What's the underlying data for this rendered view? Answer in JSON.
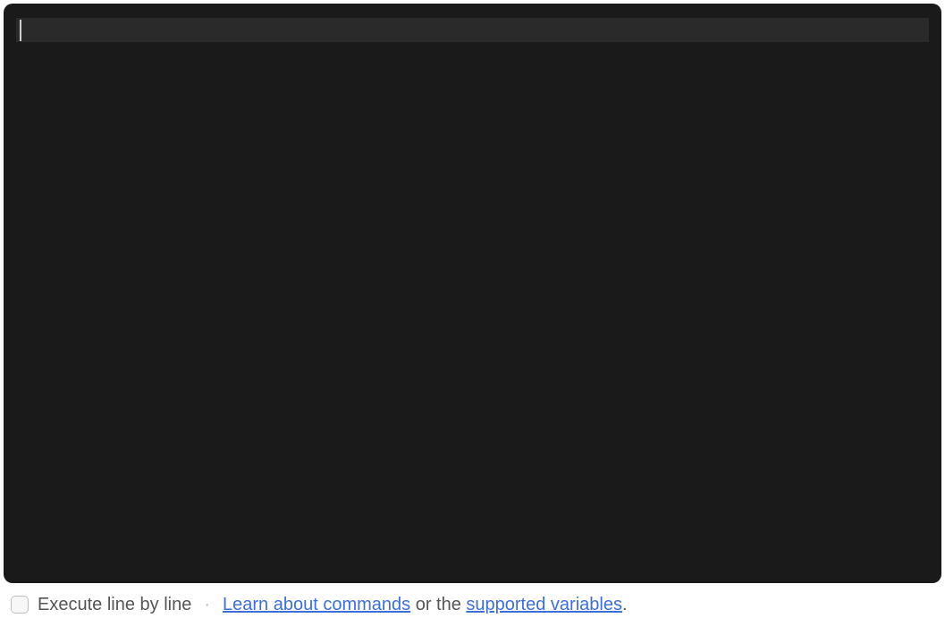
{
  "editor": {
    "content": ""
  },
  "footer": {
    "checkbox_label": "Execute line by line",
    "separator": "·",
    "link_commands": "Learn about commands",
    "mid_text": " or the ",
    "link_variables": "supported variables",
    "period": "."
  }
}
